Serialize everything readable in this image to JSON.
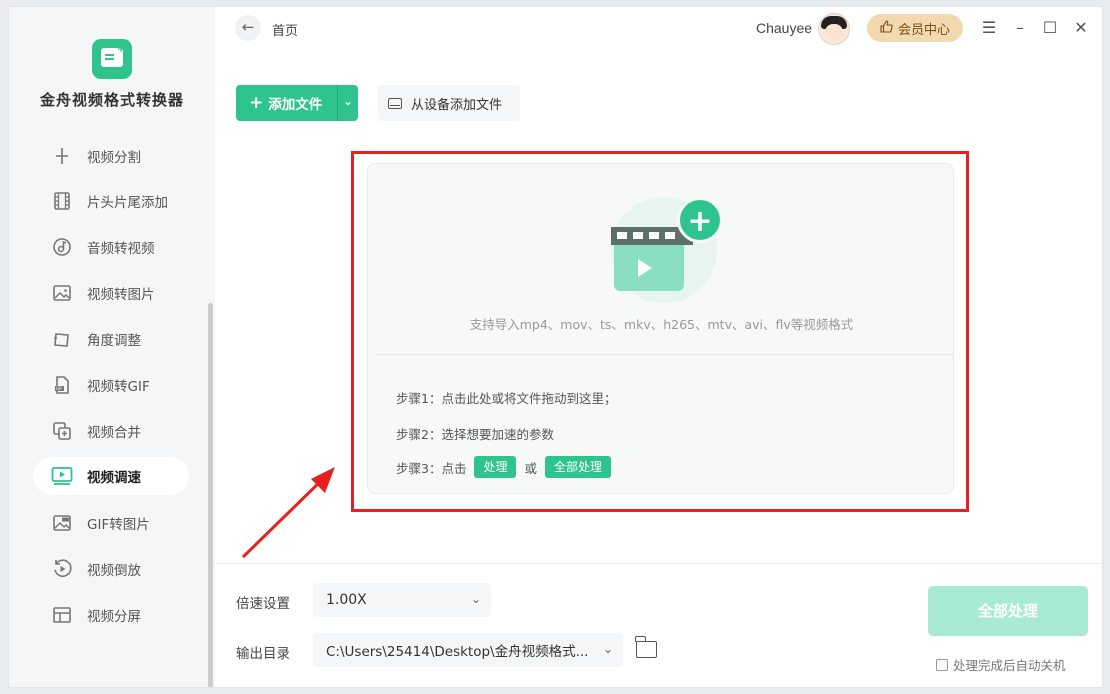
{
  "app": {
    "title": "金舟视频格式转换器"
  },
  "header": {
    "breadcrumb": "首页",
    "username": "Chauyee",
    "member_label": "会员中心"
  },
  "sidebar": {
    "items": [
      {
        "label": "视频分割",
        "icon": "split-icon",
        "active": false
      },
      {
        "label": "片头片尾添加",
        "icon": "film-icon",
        "active": false
      },
      {
        "label": "音频转视频",
        "icon": "music-disc-icon",
        "active": false
      },
      {
        "label": "视频转图片",
        "icon": "image-icon",
        "active": false
      },
      {
        "label": "角度调整",
        "icon": "rotate-frame-icon",
        "active": false
      },
      {
        "label": "视频转GIF",
        "icon": "gif-file-icon",
        "active": false
      },
      {
        "label": "视频合并",
        "icon": "merge-icon",
        "active": false
      },
      {
        "label": "视频调速",
        "icon": "speed-screen-icon",
        "active": true
      },
      {
        "label": "GIF转图片",
        "icon": "gif-image-icon",
        "active": false
      },
      {
        "label": "视频倒放",
        "icon": "reverse-play-icon",
        "active": false
      },
      {
        "label": "视频分屏",
        "icon": "split-screen-icon",
        "active": false
      }
    ]
  },
  "toolbar": {
    "add_file": "添加文件",
    "add_from_device": "从设备添加文件"
  },
  "dropzone": {
    "formats_hint": "支持导入mp4、mov、ts、mkv、h265、mtv、avi、flv等视频格式",
    "step1": "步骤1：点击此处或将文件拖动到这里；",
    "step2": "步骤2：选择想要加速的参数",
    "step3_prefix": "步骤3：点击",
    "step3_btn1": "处理",
    "step3_or": "或",
    "step3_btn2": "全部处理"
  },
  "settings": {
    "speed_label": "倍速设置",
    "speed_value": "1.00X",
    "output_label": "输出目录",
    "output_value": "C:\\Users\\25414\\Desktop\\金舟视频格式..."
  },
  "actions": {
    "process_all": "全部处理",
    "shutdown_label": "处理完成后自动关机",
    "shutdown_checked": false
  },
  "colors": {
    "accent": "#2fc48e",
    "highlight_box": "#e62020",
    "disabled_button": "#a8ead3"
  }
}
